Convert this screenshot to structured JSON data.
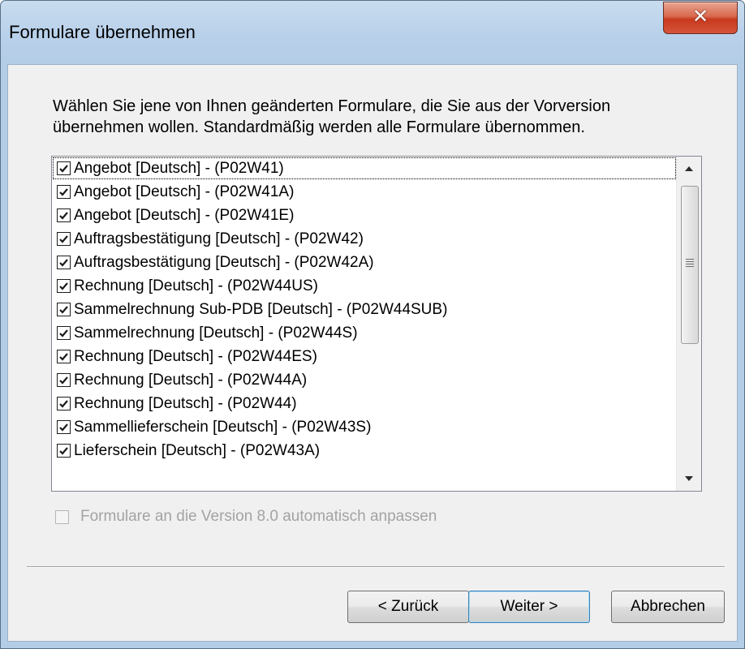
{
  "window": {
    "title": "Formulare übernehmen",
    "close_glyph": "✕"
  },
  "intro": "Wählen Sie jene von Ihnen geänderten Formulare, die Sie aus der Vorversion übernehmen wollen. Standardmäßig werden alle Formulare übernommen.",
  "forms": [
    {
      "label": "Angebot [Deutsch] - (P02W41)",
      "checked": true
    },
    {
      "label": "Angebot [Deutsch] - (P02W41A)",
      "checked": true
    },
    {
      "label": "Angebot [Deutsch] - (P02W41E)",
      "checked": true
    },
    {
      "label": "Auftragsbestätigung [Deutsch] - (P02W42)",
      "checked": true
    },
    {
      "label": "Auftragsbestätigung [Deutsch] - (P02W42A)",
      "checked": true
    },
    {
      "label": "Rechnung [Deutsch] - (P02W44US)",
      "checked": true
    },
    {
      "label": "Sammelrechnung Sub-PDB [Deutsch] - (P02W44SUB)",
      "checked": true
    },
    {
      "label": "Sammelrechnung [Deutsch] - (P02W44S)",
      "checked": true
    },
    {
      "label": "Rechnung [Deutsch] - (P02W44ES)",
      "checked": true
    },
    {
      "label": "Rechnung [Deutsch] - (P02W44A)",
      "checked": true
    },
    {
      "label": "Rechnung [Deutsch] - (P02W44)",
      "checked": true
    },
    {
      "label": "Sammellieferschein [Deutsch] - (P02W43S)",
      "checked": true
    },
    {
      "label": "Lieferschein [Deutsch] - (P02W43A)",
      "checked": true
    }
  ],
  "auto_adjust": {
    "label": "Formulare an die Version 8.0 automatisch anpassen",
    "checked": false,
    "enabled": false
  },
  "buttons": {
    "back": "< Zurück",
    "next": "Weiter >",
    "cancel": "Abbrechen"
  },
  "icons": {
    "close": "close-icon",
    "checkbox": "checkmark-icon",
    "scroll_up": "arrow-up-icon",
    "scroll_down": "arrow-down-icon"
  }
}
